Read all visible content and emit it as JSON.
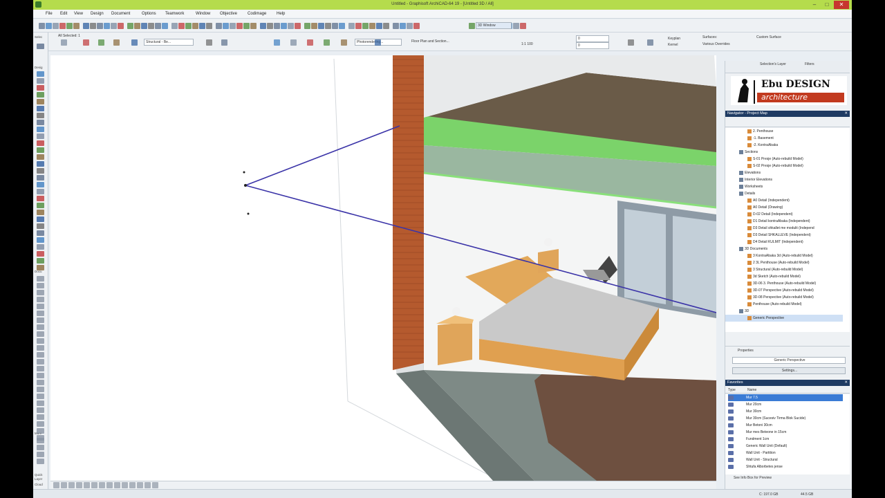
{
  "window": {
    "title": "Untitled - Graphisoft ArchiCAD-64 19 - [Untitled 3D / All]"
  },
  "menu": [
    "File",
    "Edit",
    "View",
    "Design",
    "Document",
    "Options",
    "Teamwork",
    "Window",
    "Objective",
    "Codimage",
    "Help"
  ],
  "infobox": {
    "selected": "All Selected: 1",
    "layer_field": "Structural - Be...",
    "photo_field": "Photorendering...",
    "view_field": "Floor Plan and Section...",
    "scale_label": "1:1 100",
    "value_1": "0",
    "value_2": "0",
    "keyplan_label": "Keyplan",
    "keyplan_value": "Kernel",
    "surfaces_label": "Surfaces:",
    "surfaces_value": "Various Overrides",
    "custom_label": "Custom Surface",
    "window_3d": "3D Window"
  },
  "toolbox": {
    "select_label": "Selec",
    "design_label": "Desig",
    "document_label": "Docu",
    "more_label": "More",
    "quick_label": "Quick",
    "layer_label": "Layer",
    "cloud_label": "Cloud"
  },
  "organizer": {
    "quick_layers_label": "Quick",
    "selection_layer": "Selection's Layer",
    "filters_label": "Filters"
  },
  "brand": {
    "line1": "Ebu DESIGN",
    "line2": "architecture"
  },
  "navigator": {
    "title": "Navigator - Project Map",
    "items": [
      "2. Penthouse",
      "-1. Basement",
      "-2. KontraAbaka",
      "Sections",
      "S-01 Presje (Auto-rebuild Model)",
      "S-02 Presje (Auto-rebuild Model)",
      "Elevations",
      "Interior Elevations",
      "Worksheets",
      "Details",
      "A0 Detail (Independent)",
      "A0 Detail (Drawing)",
      "D-02 Detail (Independent)",
      "D1 Detail kontraAbaka (Independent)",
      "D3 Detail shkallet me modulit (Independ",
      "D3 Detail SHKALLEVE (Independent)",
      "D4 Detail KULMIT (Independent)",
      "3D Documents",
      "3 KontraAbaka 3d (Auto-rebuild Model)",
      "2 3L Penthouse (Auto-rebuild Model)",
      "3 Structural (Auto-rebuild Model)",
      "3d Sketch (Auto-rebuild Model)",
      "3D-06 3. Penthouse (Auto-rebuild Model)",
      "3D-07 Perspective (Auto-rebuild Model)",
      "3D-08 Perspective (Auto-rebuild Model)",
      "Penthouse (Auto-rebuild Model)",
      "3D",
      "Generic Perspective"
    ]
  },
  "properties": {
    "title": "Properties",
    "view_name": "Generic Perspective",
    "settings_button": "Settings..."
  },
  "favorites": {
    "title": "Favorites",
    "col_type": "Type",
    "col_name": "Name",
    "items": [
      "Mur 7.5",
      "Mur 20cm",
      "Mur 30cm",
      "Mur 30cm (Sucesiv Tirma Blok Sucide)",
      "Mur Betoni 30cm",
      "Mur mes Beteone in 15cm",
      "Fundment 1cm",
      "Generic Wall Unit (Default)",
      "Wall Unit - Partition",
      "Wall Unit - Structural",
      "Shtufa Alborbetes jense"
    ],
    "footer": "See Info Box for Preview"
  },
  "status": {
    "disk": "C: 197.0 GB",
    "ram": "44.5 GB"
  },
  "colors": {
    "titlebar": "#b5dc4c",
    "panel_header": "#1f3b63",
    "selection": "#3a7bd5",
    "slab_green": "#7bd36a",
    "brick": "#b55a2e",
    "floor": "#7a5a44",
    "line": "#3b34a8"
  }
}
